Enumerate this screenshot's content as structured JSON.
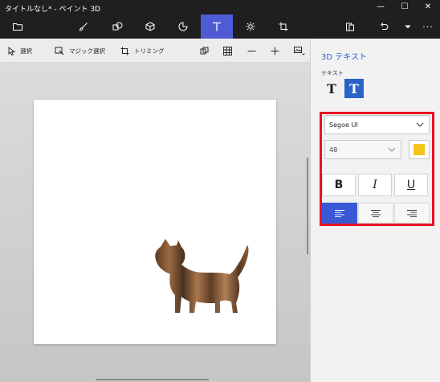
{
  "window": {
    "title": "タイトルなし* - ペイント 3D",
    "minimize_label": "—",
    "maximize_label": "☐",
    "close_label": "✕"
  },
  "toolbar": {
    "items": [
      {
        "name": "menu",
        "icon": "folder-icon"
      },
      {
        "name": "brushes",
        "icon": "brush-icon"
      },
      {
        "name": "2d-shapes",
        "icon": "2d-shapes-icon"
      },
      {
        "name": "3d-shapes",
        "icon": "cube-icon"
      },
      {
        "name": "stickers",
        "icon": "sticker-icon"
      },
      {
        "name": "text",
        "icon": "text-icon",
        "active": true
      },
      {
        "name": "effects",
        "icon": "sun-icon"
      },
      {
        "name": "canvas",
        "icon": "canvas-icon"
      },
      {
        "name": "paste",
        "icon": "paste-icon"
      },
      {
        "name": "undo",
        "icon": "undo-icon"
      },
      {
        "name": "history",
        "icon": "chevron-down-icon"
      },
      {
        "name": "more",
        "icon": "more-icon"
      }
    ],
    "more_label": "···"
  },
  "commandbar": {
    "select_label": "選択",
    "magic_select_label": "マジック選択",
    "crop_label": "トリミング"
  },
  "panel": {
    "title": "3D テキスト",
    "text_label": "テキスト",
    "plain_text_glyph": "T",
    "three_d_text_glyph": "T",
    "font_name": "Segoe UI",
    "font_size": "48",
    "text_color": "#f5c518",
    "bold_label": "B",
    "italic_label": "I",
    "underline_label": "U",
    "alignment_selected": "left"
  },
  "colors": {
    "accent": "#4f5bd5",
    "highlight_border": "#e81123",
    "panel_title": "#2a63c8"
  }
}
